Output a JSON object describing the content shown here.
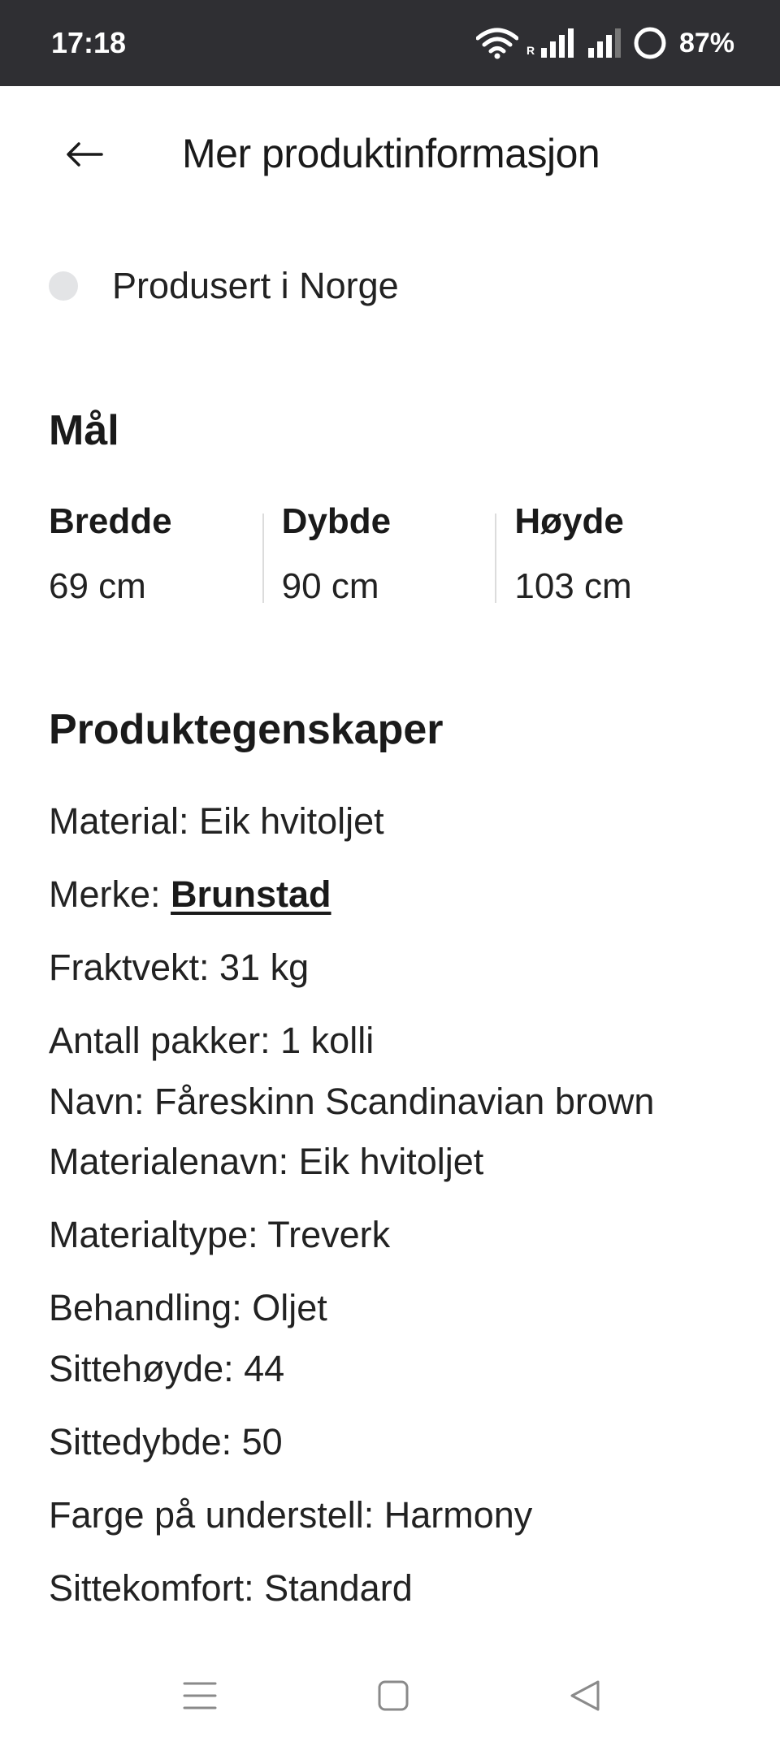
{
  "status_bar": {
    "time": "17:18",
    "battery": "87%",
    "icons": [
      "wifi-icon",
      "roaming-signal-icon",
      "signal-icon",
      "battery-ring-icon"
    ]
  },
  "header": {
    "title": "Mer produktinformasjon",
    "back_icon": "arrow-left-icon"
  },
  "origin": {
    "text": "Produsert i Norge"
  },
  "dimensions": {
    "title": "Mål",
    "items": [
      {
        "label": "Bredde",
        "value": "69 cm"
      },
      {
        "label": "Dybde",
        "value": "90 cm"
      },
      {
        "label": "Høyde",
        "value": "103 cm"
      }
    ]
  },
  "properties": {
    "title": "Produktegenskaper",
    "items": [
      {
        "text": "Material: Eik hvitoljet"
      },
      {
        "label": "Merke: ",
        "link": "Brunstad"
      },
      {
        "text": "Fraktvekt: 31 kg"
      },
      {
        "text": "Antall pakker: 1 kolli"
      },
      {
        "text": "Navn: Fåreskinn Scandinavian brown"
      },
      {
        "text": "Materialenavn: Eik hvitoljet"
      },
      {
        "text": "Materialtype: Treverk"
      },
      {
        "text": "Behandling: Oljet"
      },
      {
        "text": "Sittehøyde: 44"
      },
      {
        "text": "Sittedybde: 50"
      },
      {
        "text": "Farge på understell: Harmony"
      },
      {
        "text": "Sittekomfort: Standard"
      }
    ]
  },
  "nav_bar": {
    "buttons": [
      "menu-icon",
      "home-square-icon",
      "back-triangle-icon"
    ]
  },
  "colors": {
    "status_bar_bg": "#2f2f33",
    "background": "#ffffff",
    "text": "#1f1f1f",
    "dot": "#e3e4e6",
    "divider": "#dcdcdc"
  }
}
